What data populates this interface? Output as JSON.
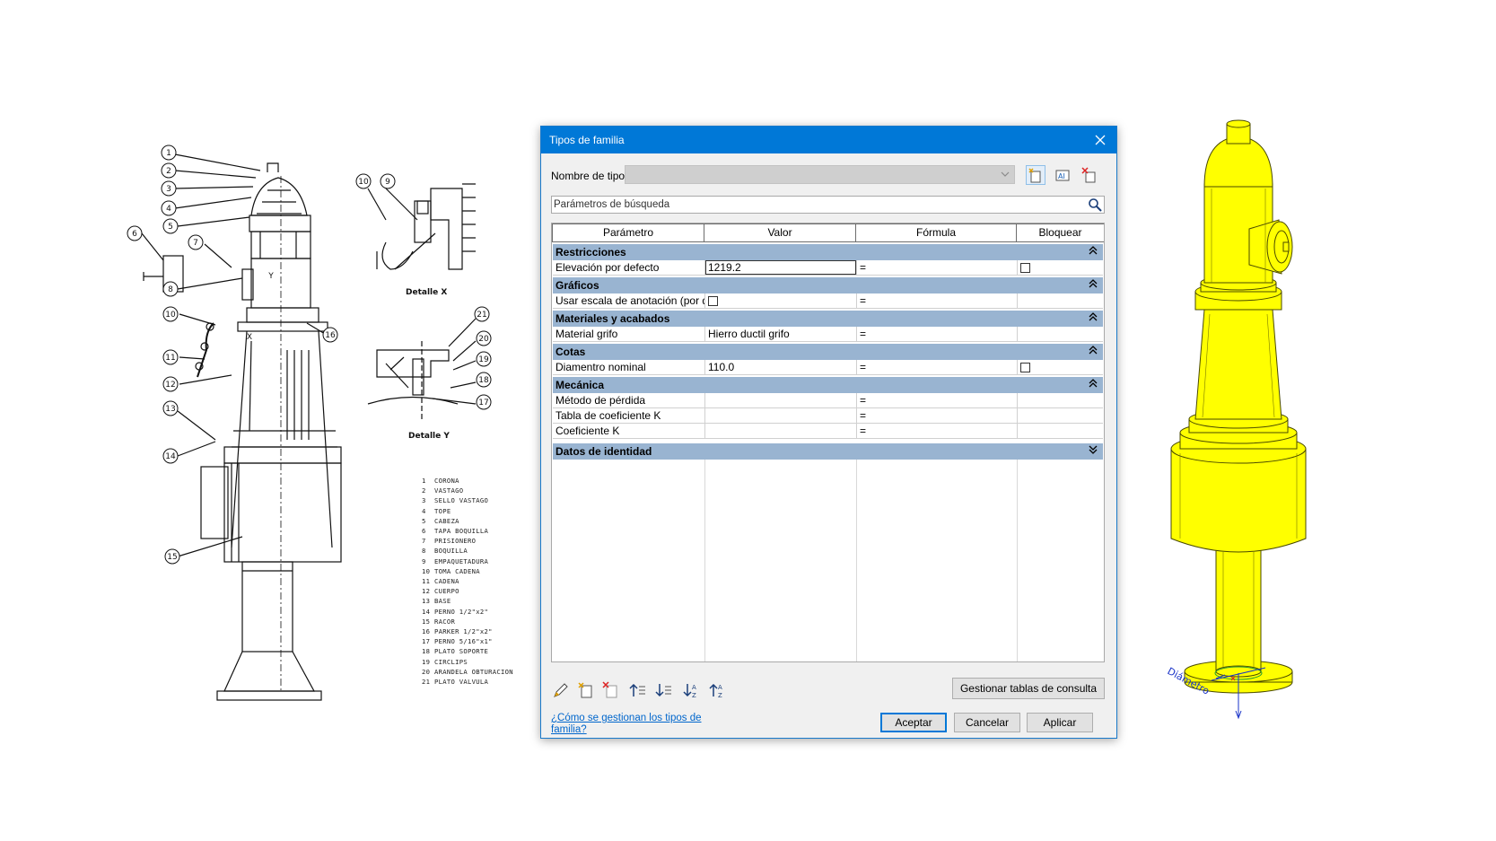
{
  "drawing": {
    "callouts": [
      "1",
      "2",
      "3",
      "4",
      "5",
      "6",
      "7",
      "8",
      "10",
      "11",
      "12",
      "13",
      "14",
      "15",
      "16",
      "10",
      "9",
      "21",
      "20",
      "19",
      "18",
      "17",
      "X",
      "Y"
    ],
    "detail_x_caption": "Detalle X",
    "detail_y_caption": "Detalle Y",
    "legend": [
      {
        "n": "1",
        "t": "CORONA"
      },
      {
        "n": "2",
        "t": "VASTAGO"
      },
      {
        "n": "3",
        "t": "SELLO VASTAGO"
      },
      {
        "n": "4",
        "t": "TOPE"
      },
      {
        "n": "5",
        "t": "CABEZA"
      },
      {
        "n": "6",
        "t": "TAPA BOQUILLA"
      },
      {
        "n": "7",
        "t": "PRISIONERO"
      },
      {
        "n": "8",
        "t": "BOQUILLA"
      },
      {
        "n": "9",
        "t": "EMPAQUETADURA"
      },
      {
        "n": "10",
        "t": "TOMA CADENA"
      },
      {
        "n": "11",
        "t": "CADENA"
      },
      {
        "n": "12",
        "t": "CUERPO"
      },
      {
        "n": "13",
        "t": "BASE"
      },
      {
        "n": "14",
        "t": "PERNO 1/2\"x2\""
      },
      {
        "n": "15",
        "t": "RACOR"
      },
      {
        "n": "16",
        "t": "PARKER 1/2\"x2\""
      },
      {
        "n": "17",
        "t": "PERNO 5/16\"x1\""
      },
      {
        "n": "18",
        "t": "PLATO SOPORTE"
      },
      {
        "n": "19",
        "t": "CIRCLIPS"
      },
      {
        "n": "20",
        "t": "ARANDELA OBTURACION"
      },
      {
        "n": "21",
        "t": "PLATO VALVULA"
      }
    ]
  },
  "dialog": {
    "title": "Tipos de familia",
    "type_name_label": "Nombre de tipo:",
    "type_name_value": "",
    "search": {
      "placeholder": "Parámetros de búsqueda"
    },
    "columns": [
      "Parámetro",
      "Valor",
      "Fórmula",
      "Bloquear"
    ],
    "groups": [
      {
        "name": "Restricciones",
        "expanded": true,
        "rows": [
          {
            "param": "Elevación por defecto",
            "value": "1219.2",
            "value_type": "text",
            "editing": true,
            "formula": "=",
            "locked": false,
            "has_lock": true
          }
        ]
      },
      {
        "name": "Gráficos",
        "expanded": true,
        "rows": [
          {
            "param": "Usar escala de anotación (por defecto)",
            "value": "",
            "value_type": "checkbox",
            "checked": false,
            "formula": "=",
            "has_lock": false
          }
        ]
      },
      {
        "name": "Materiales y acabados",
        "expanded": true,
        "rows": [
          {
            "param": "Material grifo",
            "value": "Hierro ductil grifo",
            "value_type": "text",
            "formula": "=",
            "has_lock": false
          }
        ]
      },
      {
        "name": "Cotas",
        "expanded": true,
        "rows": [
          {
            "param": "Diamentro nominal",
            "value": "110.0",
            "value_type": "text",
            "formula": "=",
            "locked": false,
            "has_lock": true
          }
        ]
      },
      {
        "name": "Mecánica",
        "expanded": true,
        "rows": [
          {
            "param": "Método de pérdida",
            "value": "",
            "value_type": "text",
            "formula": "=",
            "has_lock": false
          },
          {
            "param": "Tabla de coeficiente K",
            "value": "",
            "value_type": "text",
            "formula": "=",
            "has_lock": false
          },
          {
            "param": "Coeficiente K",
            "value": "",
            "value_type": "text",
            "formula": "=",
            "has_lock": false
          }
        ]
      },
      {
        "name": "Datos de identidad",
        "expanded": false,
        "rows": []
      }
    ],
    "bottom_toolbar_icons": [
      "edit-parameter-icon",
      "new-parameter-icon",
      "delete-parameter-icon",
      "move-parameter-up-icon",
      "move-parameter-down-icon",
      "sort-ascending-icon",
      "sort-descending-icon"
    ],
    "manage_tables_label": "Gestionar tablas de consulta",
    "help_link": "¿Cómo se gestionan los tipos de familia?",
    "ok_label": "Aceptar",
    "cancel_label": "Cancelar",
    "apply_label": "Aplicar"
  },
  "model": {
    "color": "#ffff00",
    "dimension_label": "Diámetro"
  },
  "colors": {
    "titlebar": "#0078d7",
    "group_header": "#99b4d1",
    "link": "#0066cc",
    "model_yellow": "#ffff00",
    "dimension_blue": "#1a33c8"
  }
}
